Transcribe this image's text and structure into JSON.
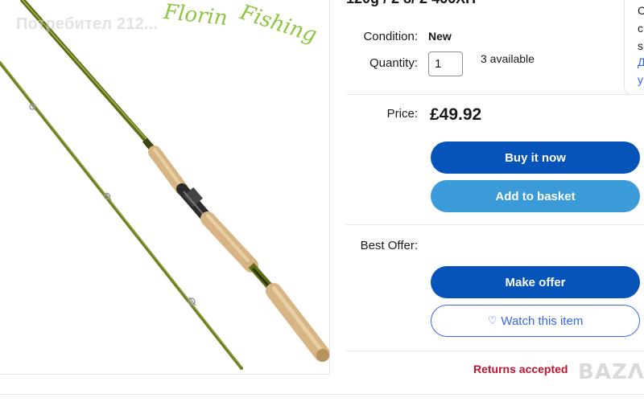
{
  "watermark": {
    "user_text": "Потребител 212...",
    "signature_left": "Florin",
    "signature_right": "Fishing",
    "site_logo": "BAZAR"
  },
  "listing": {
    "subtitle_cut": "120g / 2 8/ 2 466XH",
    "condition_label": "Condition:",
    "condition_value": "New",
    "quantity_label": "Quantity:",
    "quantity_value": "1",
    "availability": "3 available",
    "price_label": "Price:",
    "price_value": "£49.92",
    "best_offer_label": "Best Offer:",
    "returns": "Returns accepted"
  },
  "buttons": {
    "buy_now": "Buy it now",
    "add_to_basket": "Add to basket",
    "make_offer": "Make offer",
    "watch_item": "Watch this item"
  },
  "side_card": {
    "line1": "C",
    "line2": "c",
    "line3": "s",
    "line4": "Д",
    "line5": "y"
  },
  "colors": {
    "primary_blue": "#0654ba",
    "secondary_blue": "#3b9bd9",
    "link_blue": "#3665f3",
    "returns_red": "#c4122f",
    "rod_green": "#6b7a1f",
    "cork": "#d9b98a"
  },
  "icons": {
    "watch": "heart-icon"
  }
}
